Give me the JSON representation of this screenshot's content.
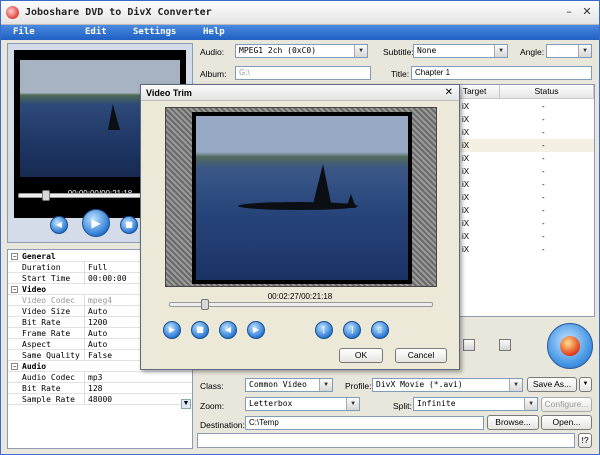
{
  "app": {
    "title": "Joboshare DVD to DivX Converter"
  },
  "menu": [
    "File",
    "Edit",
    "Settings",
    "Help"
  ],
  "preview": {
    "time": "00:00:00/00:21:18",
    "progress": 0.15
  },
  "properties": [
    {
      "group": "General"
    },
    {
      "key": "Duration",
      "value": "Full"
    },
    {
      "key": "Start Time",
      "value": "00:00:00"
    },
    {
      "group": "Video"
    },
    {
      "key": "Video Codec",
      "value": "mpeg4",
      "disabled": true
    },
    {
      "key": "Video Size",
      "value": "Auto"
    },
    {
      "key": "Bit Rate",
      "value": "1200"
    },
    {
      "key": "Frame Rate",
      "value": "Auto"
    },
    {
      "key": "Aspect",
      "value": "Auto"
    },
    {
      "key": "Same Quality",
      "value": "False"
    },
    {
      "group": "Audio"
    },
    {
      "key": "Audio Codec",
      "value": "mp3"
    },
    {
      "key": "Bit Rate",
      "value": "128"
    },
    {
      "key": "Sample Rate",
      "value": "48000"
    }
  ],
  "top": {
    "audio_label": "Audio:",
    "audio_value": "MPEG1 2ch (0xC0)",
    "subtitle_label": "Subtitle:",
    "subtitle_value": "None",
    "angle_label": "Angle:",
    "angle_value": "",
    "album_label": "Album:",
    "album_value": "G:\\",
    "title_label": "Title:",
    "title_value": "Chapter 1"
  },
  "list": {
    "headers": {
      "target": "Target",
      "status": "Status"
    },
    "rows": [
      {
        "target": "iX",
        "status": "-"
      },
      {
        "target": "iX",
        "status": "-"
      },
      {
        "target": "iX",
        "status": "-"
      },
      {
        "target": "iX",
        "status": "-"
      },
      {
        "target": "iX",
        "status": "-"
      },
      {
        "target": "iX",
        "status": "-"
      },
      {
        "target": "iX",
        "status": "-"
      },
      {
        "target": "iX",
        "status": "-"
      },
      {
        "target": "iX",
        "status": "-"
      },
      {
        "target": "iX",
        "status": "-"
      },
      {
        "target": "iX",
        "status": "-"
      },
      {
        "target": "iX",
        "status": "-"
      }
    ],
    "selected_index": 3
  },
  "bottom": {
    "class_label": "Class:",
    "class_value": "Common Video",
    "profile_label": "Profile:",
    "profile_value": "DivX Movie  (*.avi)",
    "save_as": "Save As...",
    "zoom_label": "Zoom:",
    "zoom_value": "Letterbox",
    "split_label": "Split:",
    "split_value": "Infinite",
    "configure": "Configure...",
    "destination_label": "Destination:",
    "destination_value": "C:\\Temp",
    "browse": "Browse...",
    "open": "Open...",
    "help": "!?"
  },
  "dialog": {
    "title": "Video Trim",
    "time": "00:02:27/00:21:18",
    "progress": 0.12,
    "ok": "OK",
    "cancel": "Cancel"
  }
}
